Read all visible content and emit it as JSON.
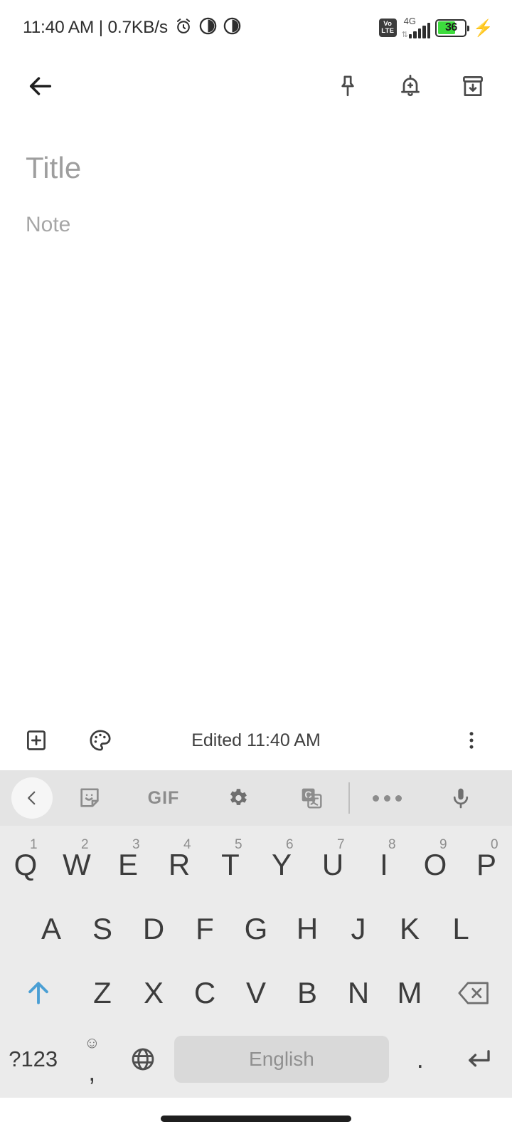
{
  "status_bar": {
    "text": "11:40 AM | 0.7KB/s",
    "icons_left": [
      "alarm-icon",
      "dnd-half-circle-icon",
      "theme-half-circle-icon"
    ],
    "volte_line1": "Vo",
    "volte_line2": "LTE",
    "network_type": "4G",
    "battery_percent": "36",
    "charging": true,
    "battery_color": "#3ddc3d"
  },
  "appbar": {
    "back": "back-arrow-icon",
    "actions": [
      {
        "name": "pin-icon",
        "label": "Pin note"
      },
      {
        "name": "reminder-bell-icon",
        "label": "Add reminder"
      },
      {
        "name": "archive-icon",
        "label": "Archive"
      }
    ]
  },
  "note": {
    "title_placeholder": "Title",
    "body_placeholder": "Note",
    "title_value": "",
    "body_value": ""
  },
  "note_toolbar": {
    "add_label": "add-box-icon",
    "palette_label": "color-palette-icon",
    "edited_text": "Edited 11:40 AM",
    "more_label": "more-options-icon"
  },
  "keyboard": {
    "toolbar": [
      {
        "name": "kb-back-chevron-icon",
        "label": ""
      },
      {
        "name": "sticker-icon",
        "label": ""
      },
      {
        "name": "gif-icon",
        "label": "GIF"
      },
      {
        "name": "settings-gear-icon",
        "label": ""
      },
      {
        "name": "google-translate-icon",
        "label": "G"
      },
      {
        "name": "overflow-dots-icon",
        "label": ""
      },
      {
        "name": "microphone-icon",
        "label": ""
      }
    ],
    "row1": [
      {
        "key": "Q",
        "sup": "1"
      },
      {
        "key": "W",
        "sup": "2"
      },
      {
        "key": "E",
        "sup": "3"
      },
      {
        "key": "R",
        "sup": "4"
      },
      {
        "key": "T",
        "sup": "5"
      },
      {
        "key": "Y",
        "sup": "6"
      },
      {
        "key": "U",
        "sup": "7"
      },
      {
        "key": "I",
        "sup": "8"
      },
      {
        "key": "O",
        "sup": "9"
      },
      {
        "key": "P",
        "sup": "0"
      }
    ],
    "row2": [
      "A",
      "S",
      "D",
      "F",
      "G",
      "H",
      "J",
      "K",
      "L"
    ],
    "row3": [
      "Z",
      "X",
      "C",
      "V",
      "B",
      "N",
      "M"
    ],
    "shift": "shift-arrow-icon",
    "shift_active_color": "#4a9fd4",
    "backspace": "backspace-icon",
    "row4": {
      "symbols": "?123",
      "emoji_top": "☺",
      "comma": ",",
      "globe": "globe-icon",
      "space_label": "English",
      "period": ".",
      "enter": "enter-icon"
    }
  },
  "navbar": {
    "pill": "gesture-nav-pill"
  }
}
